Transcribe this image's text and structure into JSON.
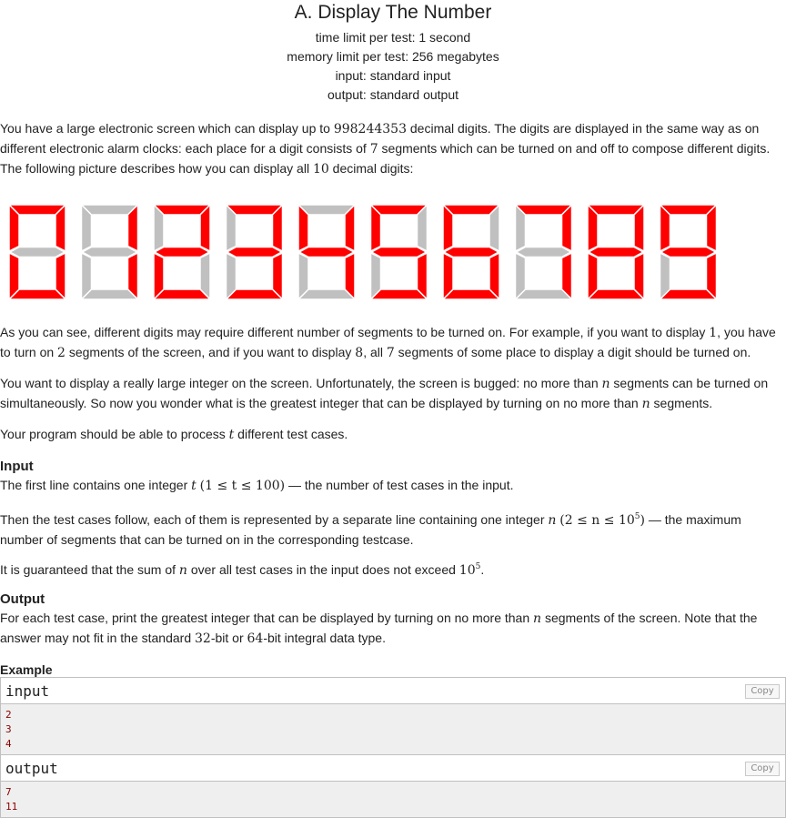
{
  "problem": {
    "title": "A. Display The Number",
    "meta": {
      "time_limit": "time limit per test: 1 second",
      "memory_limit": "memory limit per test: 256 megabytes",
      "input": "input: standard input",
      "output": "output: standard output"
    }
  },
  "statement": {
    "p1": {
      "a": "You have a large electronic screen which can display up to ",
      "num": "998244353",
      "b": " decimal digits. The digits are displayed in the same way as on different electronic alarm clocks: each place for a digit consists of ",
      "seven": "7",
      "c": " segments which can be turned on and off to compose different digits. The following picture describes how you can display all ",
      "ten": "10",
      "d": " decimal digits:"
    },
    "p2": {
      "a": "As you can see, different digits may require different number of segments to be turned on. For example, if you want to display ",
      "one": "1",
      "b": ", you have to turn on ",
      "two": "2",
      "c": " segments of the screen, and if you want to display ",
      "eight": "8",
      "d": ", all ",
      "seven": "7",
      "e": " segments of some place to display a digit should be turned on."
    },
    "p3": {
      "a": "You want to display a really large integer on the screen. Unfortunately, the screen is bugged: no more than ",
      "n1": "n",
      "b": " segments can be turned on simultaneously. So now you wonder what is the greatest integer that can be displayed by turning on no more than ",
      "n2": "n",
      "c": " segments."
    },
    "p4": {
      "a": "Your program should be able to process ",
      "t": "t",
      "b": " different test cases."
    }
  },
  "input_section": {
    "title": "Input",
    "p1": {
      "a": "The first line contains one integer ",
      "t": "t",
      "range": "(1 ≤ t ≤ 100)",
      "b": " — the number of test cases in the input."
    },
    "p2": {
      "a": "Then the test cases follow, each of them is represented by a separate line containing one integer ",
      "n": "n",
      "range_open": "(2 ≤ n ≤ 10",
      "range_exp": "5",
      "range_close": ")",
      "b": " — the maximum number of segments that can be turned on in the corresponding testcase."
    },
    "p3": {
      "a": "It is guaranteed that the sum of ",
      "n": "n",
      "b": " over all test cases in the input does not exceed ",
      "base": "10",
      "exp": "5",
      "c": "."
    }
  },
  "output_section": {
    "title": "Output",
    "p1": {
      "a": "For each test case, print the greatest integer that can be displayed by turning on no more than ",
      "n": "n",
      "b": " segments of the screen. Note that the answer may not fit in the standard ",
      "b32": "32",
      "c": "-bit or ",
      "b64": "64",
      "d": "-bit integral data type."
    }
  },
  "example": {
    "title": "Example",
    "input_label": "input",
    "output_label": "output",
    "copy_label": "Copy",
    "input_lines": [
      "2",
      "3",
      "4"
    ],
    "output_lines": [
      "7",
      "11"
    ]
  },
  "seven_segment": {
    "digits": [
      0,
      1,
      2,
      3,
      4,
      5,
      6,
      7,
      8,
      9
    ],
    "on_color": "#ff0000",
    "off_color": "#c0c0c0"
  }
}
